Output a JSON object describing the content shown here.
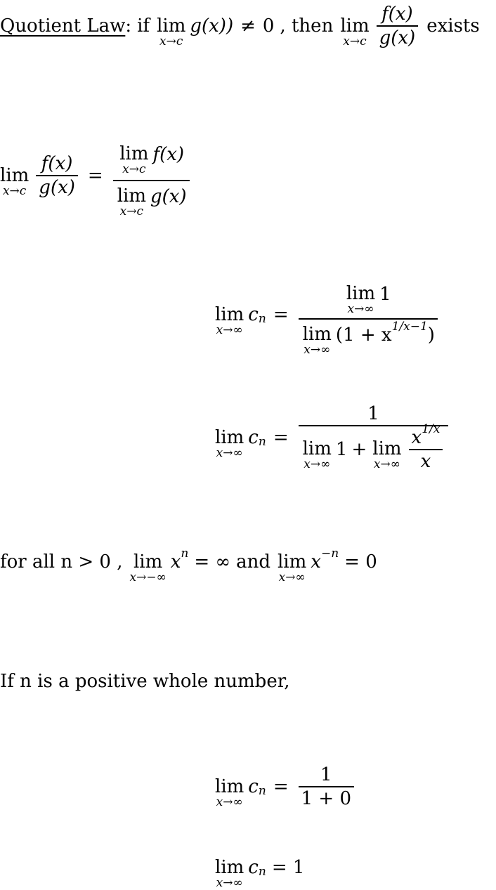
{
  "line1": {
    "label": "Quotient Law",
    "colon": ":",
    "if_text": "if",
    "lim": "lim",
    "lim_sub": "x→c",
    "expr1": "g(x))",
    "neq": "≠",
    "zero": "0",
    "comma_then": ", then",
    "num": "f(x)",
    "den": "g(x)",
    "exists": "exists"
  },
  "eq1": {
    "lim": "lim",
    "lim_sub": "x→c",
    "num": "f(x)",
    "den": "g(x)",
    "equals": "=",
    "rhs_num_expr": "f(x)",
    "rhs_den_expr": "g(x)"
  },
  "eq2": {
    "lim": "lim",
    "lim_sub": "x→∞",
    "lhs_var": "c",
    "lhs_sub": "n",
    "equals": "=",
    "num_expr": "1",
    "den_open": "(1 + x",
    "den_sup": "1/x−1",
    "den_close": ")"
  },
  "eq3": {
    "lim": "lim",
    "lim_sub": "x→∞",
    "lhs_var": "c",
    "lhs_sub": "n",
    "equals": "=",
    "num": "1",
    "den_term1": "1",
    "plus": "+",
    "inner_num_base": "x",
    "inner_num_sup": "1/x",
    "inner_den": "x"
  },
  "line2": {
    "text_before": "for all n > 0 ,",
    "lim": "lim",
    "lim_sub1": "x→−∞",
    "base1": "x",
    "sup1": "n",
    "eq_inf": "= ∞",
    "and": "and",
    "lim_sub2": "x→∞",
    "base2": "x",
    "sup2": "−n",
    "eq_zero": "= 0"
  },
  "line3": {
    "text": "If n is a positive whole number,"
  },
  "eq4": {
    "lim": "lim",
    "lim_sub": "x→∞",
    "lhs_var": "c",
    "lhs_sub": "n",
    "equals": "=",
    "num": "1",
    "den": "1 + 0"
  },
  "eq5": {
    "lim": "lim",
    "lim_sub": "x→∞",
    "lhs_var": "c",
    "lhs_sub": "n",
    "equals": "= 1"
  }
}
